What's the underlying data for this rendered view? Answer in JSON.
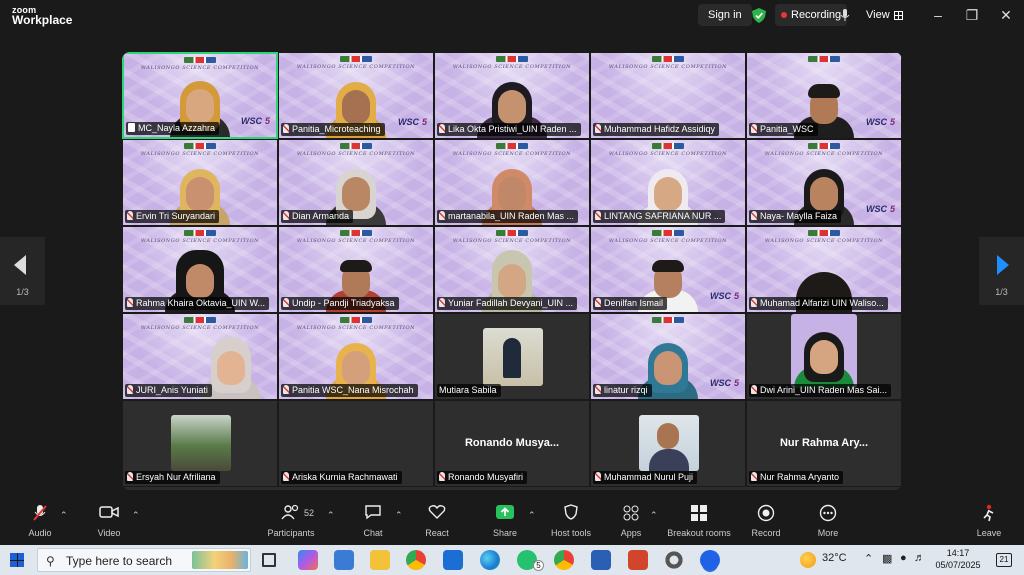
{
  "app": {
    "logo_top": "zoom",
    "logo_bottom": "Workplace"
  },
  "titlebar": {
    "sign_in": "Sign in",
    "recording": "Recording",
    "view": "View"
  },
  "pager": {
    "left": "1/3",
    "right": "1/3"
  },
  "banner": {
    "title": "WALISONGO SCIENCE COMPETITION",
    "wsc": "WSC"
  },
  "tiles": [
    "MC_Nayla Azzahra",
    "Panitia_Microteaching",
    "Lika Okta Pristiwi_UIN Raden ...",
    "Muhammad Hafidz Assidiqy",
    "Panitia_WSC",
    "Ervin Tri Suryandari",
    "Dian Armanda",
    "martanabila_UIN Raden Mas ...",
    "LINTANG SAFRIANA NUR ...",
    "Naya- Maylla Faiza",
    "Rahma Khaira Oktavia_UIN W...",
    "Undip - Pandji Triadyaksa",
    "Yuniar Fadillah Devyani_UIN ...",
    "Denilfan Ismail",
    "Muhamad Alfarizi UIN Waliso...",
    "JURI_Anis Yuniati",
    "Panitia WSC_Nana Misrochah",
    "Mutiara Sabila",
    "linatur rizqi",
    "Dwi Arini_UIN Raden Mas Sai...",
    "Ersyah Nur Afriliana",
    "Ariska Kurnia Rachmawati",
    "Ronando Musyafiri",
    "Muhammad Nurul Puji",
    "Nur Rahma Aryanto"
  ],
  "big_names": {
    "ronando": "Ronando  Musya...",
    "nur_rahma": "Nur Rahma Ary..."
  },
  "toolbar": {
    "audio": "Audio",
    "video": "Video",
    "participants": "Participants",
    "participants_count": "52",
    "chat": "Chat",
    "react": "React",
    "share": "Share",
    "host_tools": "Host tools",
    "apps": "Apps",
    "breakout": "Breakout rooms",
    "record": "Record",
    "more": "More",
    "leave": "Leave"
  },
  "taskbar": {
    "search_placeholder": "Type here to search",
    "temperature": "32°C",
    "time": "14:17",
    "date": "05/07/2025",
    "notifications": "21",
    "whatsapp_badge": "5"
  },
  "colors": {
    "active_speaker": "#2fd37a",
    "share_green": "#27c25b",
    "leave_red": "#e02828",
    "arrow_blue": "#1e8fff"
  }
}
